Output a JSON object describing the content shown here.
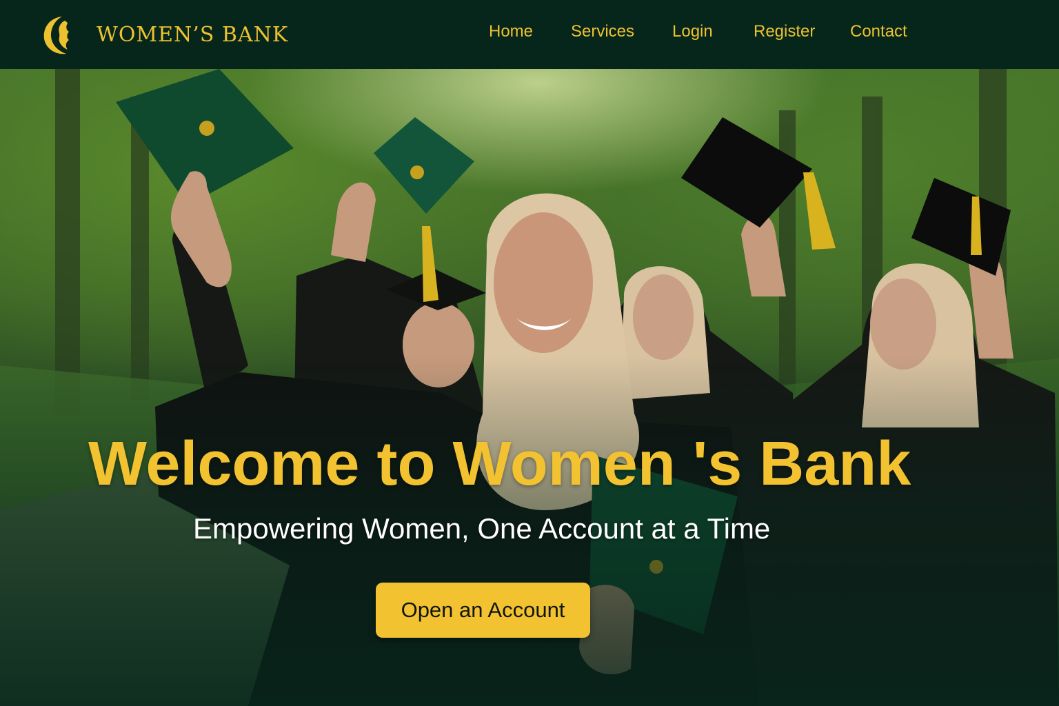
{
  "brand": {
    "name": "WOMEN’S BANK",
    "logo_icon": "woman-silhouette-crescent-icon",
    "color": "#eec12f"
  },
  "nav": {
    "items": [
      {
        "label": "Home"
      },
      {
        "label": "Services"
      },
      {
        "label": "Login"
      },
      {
        "label": "Register"
      },
      {
        "label": "Contact"
      }
    ]
  },
  "hero": {
    "title": "Welcome to Women 's Bank",
    "subtitle": "Empowering Women, One Account at a Time",
    "cta_label": "Open an Account",
    "image_subject": "graduates in hijabs and black gowns raising graduation caps in a tree-lined park"
  },
  "colors": {
    "header_bg": "#06261c",
    "accent_gold": "#f2c230",
    "text_white": "#ffffff"
  }
}
